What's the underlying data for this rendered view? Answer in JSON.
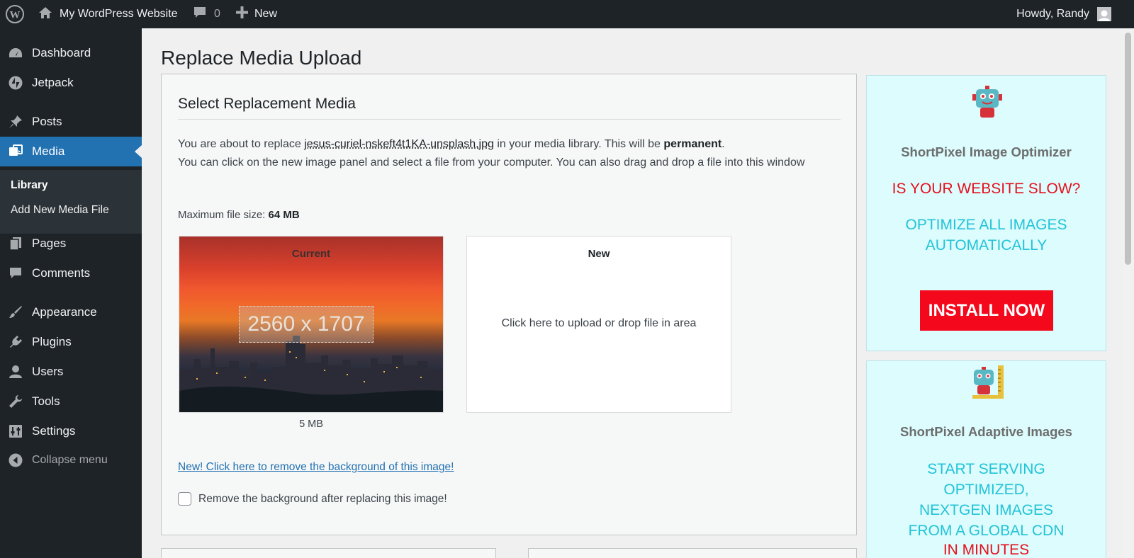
{
  "adminbar": {
    "site_name": "My WordPress Website",
    "comments_count": "0",
    "new_label": "New",
    "howdy": "Howdy, Randy"
  },
  "sidebar": {
    "items": [
      {
        "label": "Dashboard",
        "icon": "dashboard-icon"
      },
      {
        "label": "Jetpack",
        "icon": "jetpack-icon"
      },
      {
        "label": "Posts",
        "icon": "pin-icon"
      },
      {
        "label": "Media",
        "icon": "media-icon"
      },
      {
        "label": "Pages",
        "icon": "pages-icon"
      },
      {
        "label": "Comments",
        "icon": "comment-icon"
      },
      {
        "label": "Appearance",
        "icon": "brush-icon"
      },
      {
        "label": "Plugins",
        "icon": "plugin-icon"
      },
      {
        "label": "Users",
        "icon": "user-icon"
      },
      {
        "label": "Tools",
        "icon": "wrench-icon"
      },
      {
        "label": "Settings",
        "icon": "settings-icon"
      }
    ],
    "media_submenu": [
      "Library",
      "Add New Media File"
    ],
    "collapse_label": "Collapse menu"
  },
  "main": {
    "page_title": "Replace Media Upload",
    "section_title": "Select Replacement Media",
    "intro_prefix": "You are about to replace ",
    "filename": "jesus-curiel-nskeft4t1KA-unsplash.jpg",
    "intro_middle": " in your media library. This will be ",
    "intro_bold": "permanent",
    "intro_end": ".",
    "instructions": "You can click on the new image panel and select a file from your computer. You can also drag and drop a file into this window",
    "max_size_label": "Maximum file size: ",
    "max_size_value": "64 MB",
    "current_label": "Current",
    "current_dims": "2560 x 1707",
    "current_size": "5 MB",
    "new_label": "New",
    "drop_text": "Click here to upload or drop file in area",
    "bg_link": "New! Click here to remove the background of this image!",
    "bg_checkbox_label": "Remove the background after replacing this image!",
    "bg_checkbox_checked": false
  },
  "ads": {
    "ad1": {
      "title": "ShortPixel Image Optimizer",
      "red_text": "IS YOUR WEBSITE SLOW?",
      "cyan_lines": [
        "OPTIMIZE ALL IMAGES",
        "AUTOMATICALLY"
      ],
      "button": "INSTALL NOW"
    },
    "ad2": {
      "title": "ShortPixel Adaptive Images",
      "cyan_lines": [
        "START SERVING",
        "OPTIMIZED,",
        "NEXTGEN IMAGES",
        "FROM A GLOBAL CDN"
      ],
      "red_text": "IN MINUTES"
    }
  },
  "colors": {
    "admin_dark": "#1d2327",
    "accent": "#2271b1",
    "ad_red": "#e5101d",
    "ad_cyan": "#22c3d8",
    "install_button": "#f4081c"
  }
}
